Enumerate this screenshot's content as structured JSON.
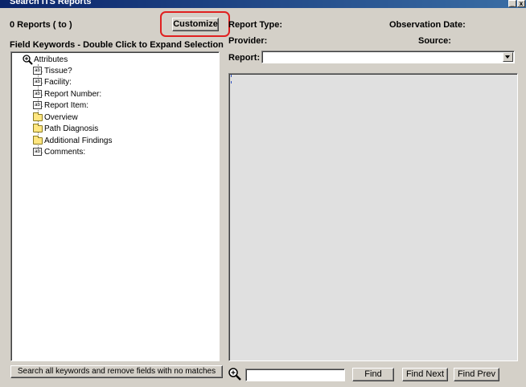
{
  "window": {
    "title": "Search ITS Reports",
    "minimize_label": "_",
    "close_label": "x"
  },
  "left": {
    "report_count": "0 Reports  ( to )",
    "customize_label": "Customize",
    "field_keywords_heading": "Field Keywords - Double Click to Expand Selection",
    "tree": {
      "root_label": "Attributes",
      "items": [
        {
          "label": "Tissue?",
          "icon": "text-field-icon"
        },
        {
          "label": "Facility:",
          "icon": "text-field-icon"
        },
        {
          "label": "Report Number:",
          "icon": "text-field-icon"
        },
        {
          "label": "Report Item:",
          "icon": "text-field-icon"
        },
        {
          "label": "Overview",
          "icon": "folder-icon"
        },
        {
          "label": "Path Diagnosis",
          "icon": "folder-icon"
        },
        {
          "label": "Additional Findings",
          "icon": "folder-icon"
        },
        {
          "label": "Comments:",
          "icon": "text-field-icon"
        }
      ]
    },
    "search_all_label": "Search all keywords and remove fields with no matches"
  },
  "right": {
    "report_type_label": "Report Type:",
    "observation_date_label": "Observation Date:",
    "provider_label": "Provider:",
    "source_label": "Source:",
    "report_label": "Report:",
    "report_select_value": "",
    "find_input_value": "",
    "find_label": "Find",
    "find_next_label": "Find Next",
    "find_prev_label": "Find Prev"
  },
  "colors": {
    "highlight_ring": "#e02020",
    "window_bg": "#d4d0c8",
    "report_area_bg": "#e0e0e0",
    "titlebar": "#0a246a"
  }
}
